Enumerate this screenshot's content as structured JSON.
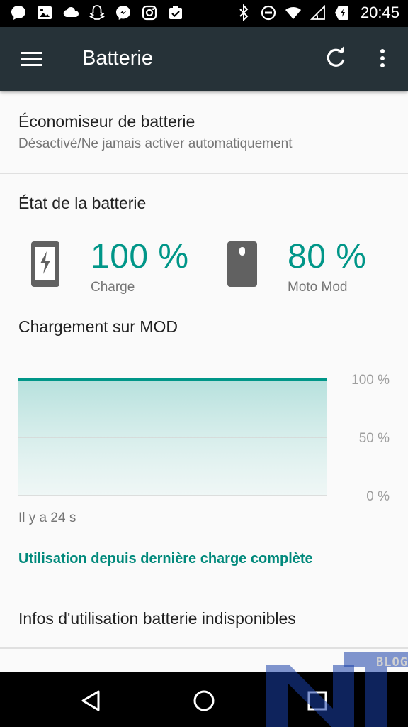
{
  "status_bar": {
    "time": "20:45",
    "left_icons": [
      "chat-bubble-icon",
      "image-icon",
      "cloud-icon",
      "ghost-icon",
      "messenger-icon",
      "instagram-icon",
      "clipboard-check-icon"
    ],
    "right_icons": [
      "bluetooth-icon",
      "do-not-disturb-icon",
      "wifi-icon",
      "signal-icon",
      "battery-charging-icon"
    ]
  },
  "app_bar": {
    "title": "Batterie"
  },
  "battery_saver": {
    "title": "Économiseur de batterie",
    "subtitle": "Désactivé/Ne jamais activer automatiquement"
  },
  "battery_state": {
    "title": "État de la batterie",
    "phone": {
      "percent": "100 %",
      "label": "Charge",
      "icon": "phone-charging-icon"
    },
    "mod": {
      "percent": "80 %",
      "label": "Moto Mod",
      "icon": "moto-mod-icon"
    }
  },
  "mod_charging": {
    "title": "Chargement sur MOD"
  },
  "chart_data": {
    "type": "area",
    "y_tick_labels": [
      "100 %",
      "50 %",
      "0 %"
    ],
    "ylim": [
      0,
      100
    ],
    "x": [
      0,
      1
    ],
    "values": [
      100,
      100
    ],
    "grid": true,
    "accent_color": "#009688"
  },
  "time_ago": "Il y a 24 s",
  "usage_link": "Utilisation depuis dernière charge complète",
  "usage_info": "Infos d'utilisation batterie indisponibles",
  "nav_bar": {
    "buttons": [
      "back-icon",
      "home-icon",
      "recents-icon"
    ]
  },
  "watermark": {
    "text": "BLOG"
  },
  "colors": {
    "accent": "#009688",
    "app_bar": "#263238",
    "status_bar": "#000000"
  }
}
